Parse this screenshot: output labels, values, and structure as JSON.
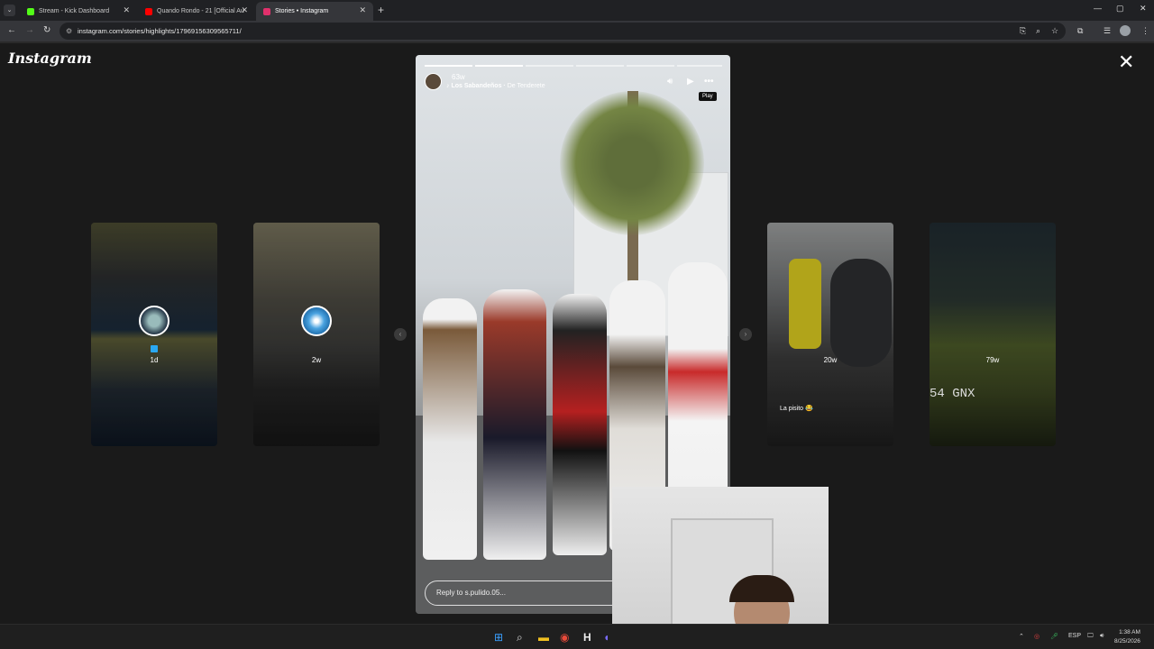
{
  "browser": {
    "tabs": [
      {
        "title": "Stream - Kick Dashboard",
        "color": "#53fc18"
      },
      {
        "title": "Quando Rondo - 21 [Official Au",
        "color": "#ff0000"
      },
      {
        "title": "Stories • Instagram",
        "color": "#e1306c",
        "active": true
      }
    ],
    "new_tab": "+",
    "url": "instagram.com/stories/highlights/17969156309565711/"
  },
  "page": {
    "logo": "Instagram",
    "close_label": "✕"
  },
  "stories": {
    "left": [
      {
        "age": "1d",
        "badge": "🔲"
      },
      {
        "age": "2w"
      }
    ],
    "right": [
      {
        "age": "20w",
        "caption": "La pisito 😂"
      },
      {
        "age": "79w",
        "plate": "54 GNX"
      }
    ],
    "current": {
      "time": "63w",
      "artist": "Los Sabandeños",
      "song": "De Tenderete",
      "progress_done": 2,
      "progress_total": 6,
      "reply_placeholder": "Reply to s.pulido.05..."
    },
    "tooltip": "Play"
  },
  "taskbar": {
    "lang": "ESP",
    "time": "1:38 AM",
    "date": "8/25/2026"
  }
}
